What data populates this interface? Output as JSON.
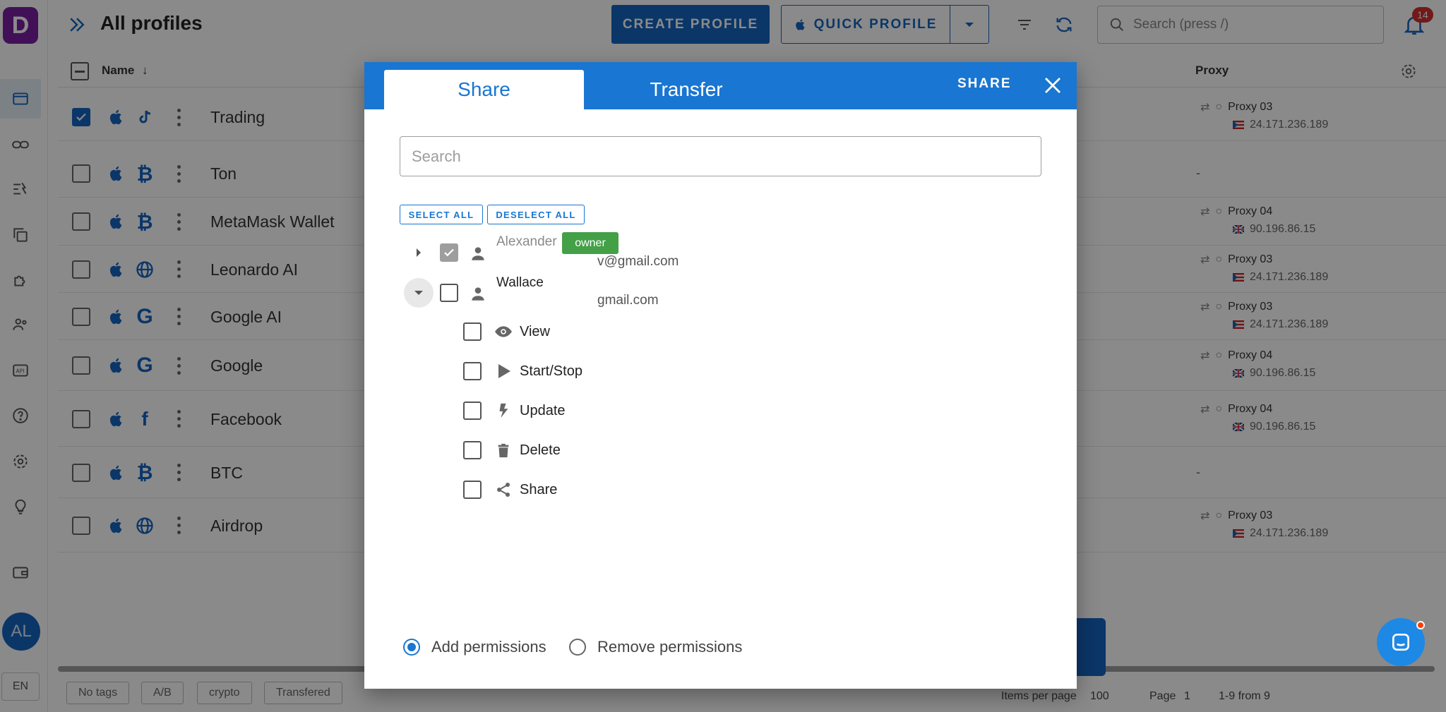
{
  "app": {
    "logo_letter": "D",
    "page_title": "All profiles",
    "create_profile_label": "CREATE PROFILE",
    "quick_profile_label": "QUICK PROFILE",
    "search_placeholder": "Search (press /)",
    "notification_count": "14",
    "avatar_initials": "AL",
    "language": "EN",
    "accent_color": "#1565c0"
  },
  "table": {
    "name_header": "Name",
    "proxy_header": "Proxy",
    "rows": [
      {
        "name": "Trading",
        "checked": true,
        "icons": [
          "apple-icon",
          "tiktok-icon"
        ],
        "proxy": {
          "name": "Proxy 03",
          "ip": "24.171.236.189"
        }
      },
      {
        "name": "Ton",
        "checked": false,
        "icons": [
          "apple-icon",
          "bitcoin-icon"
        ],
        "proxy": null
      },
      {
        "name": "MetaMask Wallet",
        "checked": false,
        "icons": [
          "apple-icon",
          "bitcoin-icon"
        ],
        "proxy": {
          "name": "Proxy 04",
          "ip": "90.196.86.15"
        }
      },
      {
        "name": "Leonardo AI",
        "checked": false,
        "icons": [
          "apple-icon",
          "globe-icon"
        ],
        "proxy": {
          "name": "Proxy 03",
          "ip": "24.171.236.189"
        }
      },
      {
        "name": "Google AI",
        "checked": false,
        "icons": [
          "apple-icon",
          "google-icon"
        ],
        "proxy": {
          "name": "Proxy 03",
          "ip": "24.171.236.189"
        }
      },
      {
        "name": "Google",
        "checked": false,
        "icons": [
          "apple-icon",
          "google-icon"
        ],
        "proxy": {
          "name": "Proxy 04",
          "ip": "90.196.86.15"
        }
      },
      {
        "name": "Facebook",
        "checked": false,
        "icons": [
          "apple-icon",
          "facebook-icon"
        ],
        "proxy": {
          "name": "Proxy 04",
          "ip": "90.196.86.15"
        }
      },
      {
        "name": "BTC",
        "checked": false,
        "icons": [
          "apple-icon",
          "bitcoin-icon"
        ],
        "proxy": null
      },
      {
        "name": "Airdrop",
        "checked": false,
        "icons": [
          "apple-icon",
          "globe-icon"
        ],
        "proxy": {
          "name": "Proxy 03",
          "ip": "24.171.236.189"
        }
      }
    ],
    "proxy_empty": "-"
  },
  "footer": {
    "tags": [
      "No tags",
      "A/B",
      "crypto",
      "Transfered"
    ],
    "items_per_page_label": "Items per page",
    "items_per_page_value": "100",
    "page_label": "Page",
    "page_value": "1",
    "range_text": "1-9 from 9"
  },
  "modal": {
    "tab_share": "Share",
    "tab_transfer": "Transfer",
    "share_button": "SHARE",
    "search_placeholder": "Search",
    "select_all": "SELECT ALL",
    "deselect_all": "DESELECT ALL",
    "users": [
      {
        "name": "Alexander",
        "email_visible": "v@gmail.com",
        "badge": "owner",
        "checked": true,
        "disabled": true,
        "expanded": false
      },
      {
        "name": "Wallace",
        "email_visible": "gmail.com",
        "badge": "",
        "checked": false,
        "disabled": false,
        "expanded": true
      }
    ],
    "permissions": [
      {
        "label": "View",
        "icon": "eye-icon",
        "checked": false
      },
      {
        "label": "Start/Stop",
        "icon": "play-icon",
        "checked": false
      },
      {
        "label": "Update",
        "icon": "bolt-icon",
        "checked": false
      },
      {
        "label": "Delete",
        "icon": "trash-icon",
        "checked": false
      },
      {
        "label": "Share",
        "icon": "share-icon",
        "checked": false
      }
    ],
    "add_permissions": "Add permissions",
    "remove_permissions": "Remove permissions",
    "mode_selected": "add",
    "header_color": "#1976d2",
    "owner_badge_color": "#43a047"
  }
}
